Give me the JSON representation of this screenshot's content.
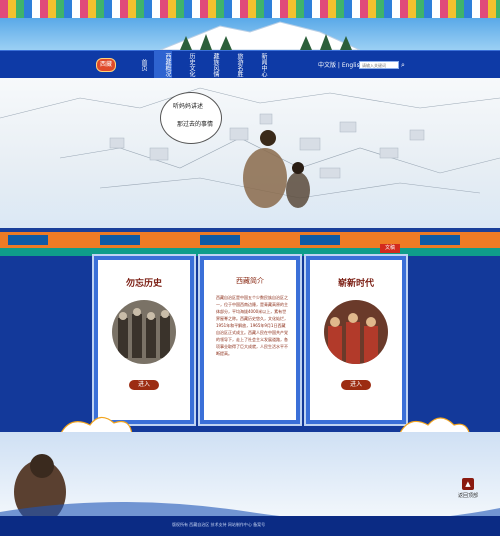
{
  "nav": {
    "logo": "西藏",
    "items": [
      "首页",
      "西藏概况",
      "历史文化",
      "藏族风情",
      "旅游名胜",
      "新闻中心"
    ],
    "lang": "中文版 | English",
    "search_placeholder": "请输入关键词"
  },
  "banner": {
    "calligraphy": [
      "听妈妈讲述",
      "那过去的事情"
    ]
  },
  "badge": "文稿",
  "panels": {
    "left": {
      "title": "勿忘历史",
      "button": "进入"
    },
    "middle": {
      "title": "西藏简介",
      "text": "西藏自治区是中国五个少数民族自治区之一，位于中国西南边陲，是青藏高原的主体部分，平均海拔4000米以上，素有世界屋脊之称。西藏历史悠久，文化灿烂，1951年和平解放，1965年9月1日西藏自治区正式成立。西藏人民在中国共产党的领导下，走上了社会主义发展道路，各项事业取得了巨大成就，人民生活水平不断提高。"
    },
    "right": {
      "title": "崭新时代",
      "button": "进入"
    }
  },
  "footer": {
    "text": "版权所有 西藏自治区 技术支持 网站制作中心 备案号",
    "top_label": "返回顶部"
  }
}
